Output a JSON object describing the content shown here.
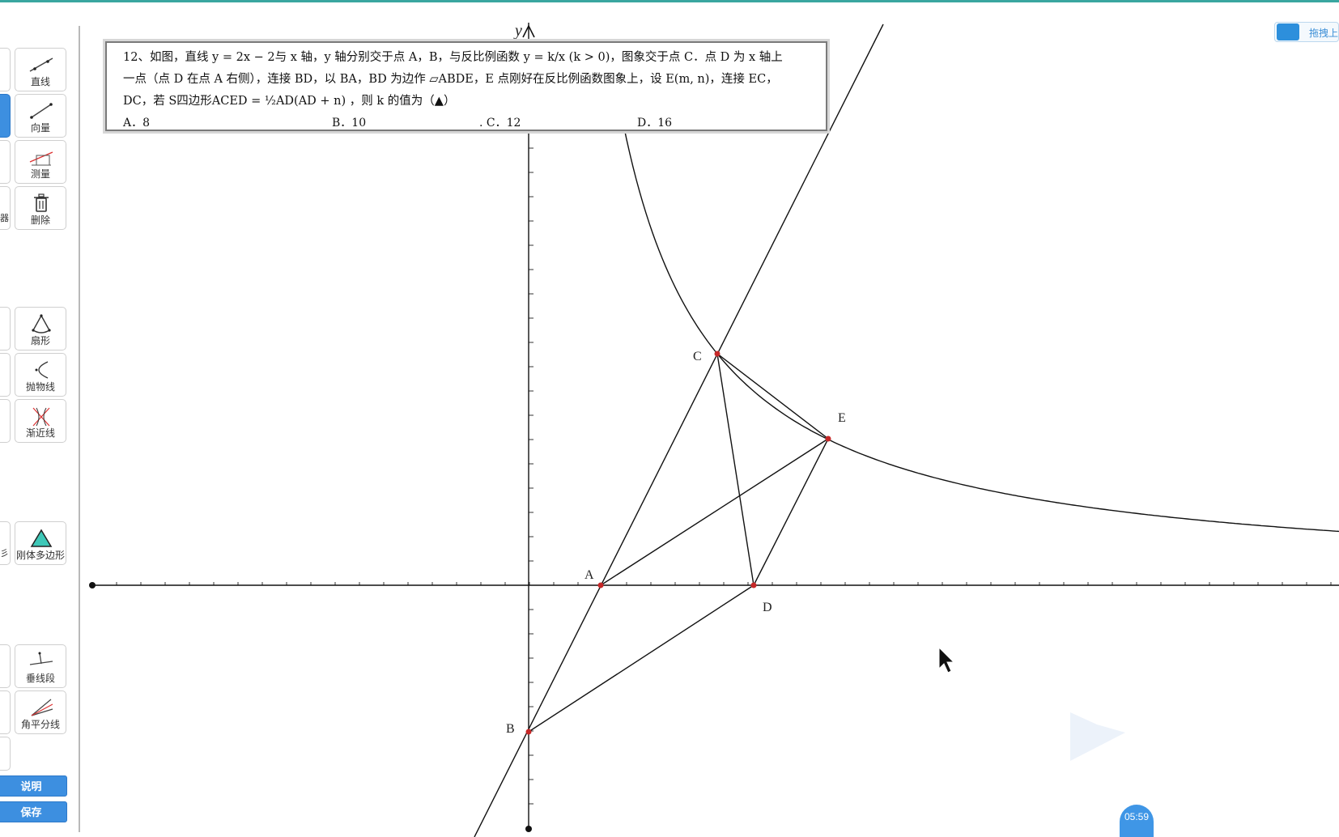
{
  "toolbar": {
    "tools": [
      {
        "name": "line-tool",
        "label": "直线"
      },
      {
        "name": "vector-tool",
        "label": "向量"
      },
      {
        "name": "measure-tool",
        "label": "测量"
      },
      {
        "name": "delete-tool",
        "label": "删除"
      },
      {
        "name": "sector-tool",
        "label": "扇形"
      },
      {
        "name": "parabola-tool",
        "label": "抛物线"
      },
      {
        "name": "asymptote-tool",
        "label": "渐近线"
      },
      {
        "name": "rigid-polygon-tool",
        "label": "刚体多边形"
      },
      {
        "name": "perpendicular-segment-tool",
        "label": "垂线段"
      },
      {
        "name": "angle-bisector-tool",
        "label": "角平分线"
      }
    ],
    "stub_labels": {
      "s4": "器",
      "s8": "彡"
    },
    "explain_label": "说明",
    "save_label": "保存"
  },
  "problem": {
    "line1": "12、如图，直线 y = 2x − 2与 x 轴，y 轴分别交于点 A，B，与反比例函数 y = k/x (k > 0)，图象交于点 C．点 D 为 x 轴上",
    "line2": "一点（点 D 在点 A 右侧），连接 BD，以 BA，BD 为边作 ▱ABDE，E 点刚好在反比例函数图象上，设 E(m, n)，连接 EC，",
    "line3": "DC，若 S四边形ACED = ½AD(AD + n) ，则 k 的值为（▲）",
    "options": [
      "A．8",
      "B．10",
      ". C．12",
      "D．16"
    ]
  },
  "graph": {
    "axis_y_label": "y",
    "points": {
      "A": "A",
      "B": "B",
      "C": "C",
      "D": "D",
      "E": "E"
    }
  },
  "cloud_widget": {
    "text": "拖拽上"
  },
  "timer": {
    "text": "05:59"
  },
  "colors": {
    "accent": "#3d8fe0",
    "point": "#c62828",
    "line": "#111111"
  }
}
